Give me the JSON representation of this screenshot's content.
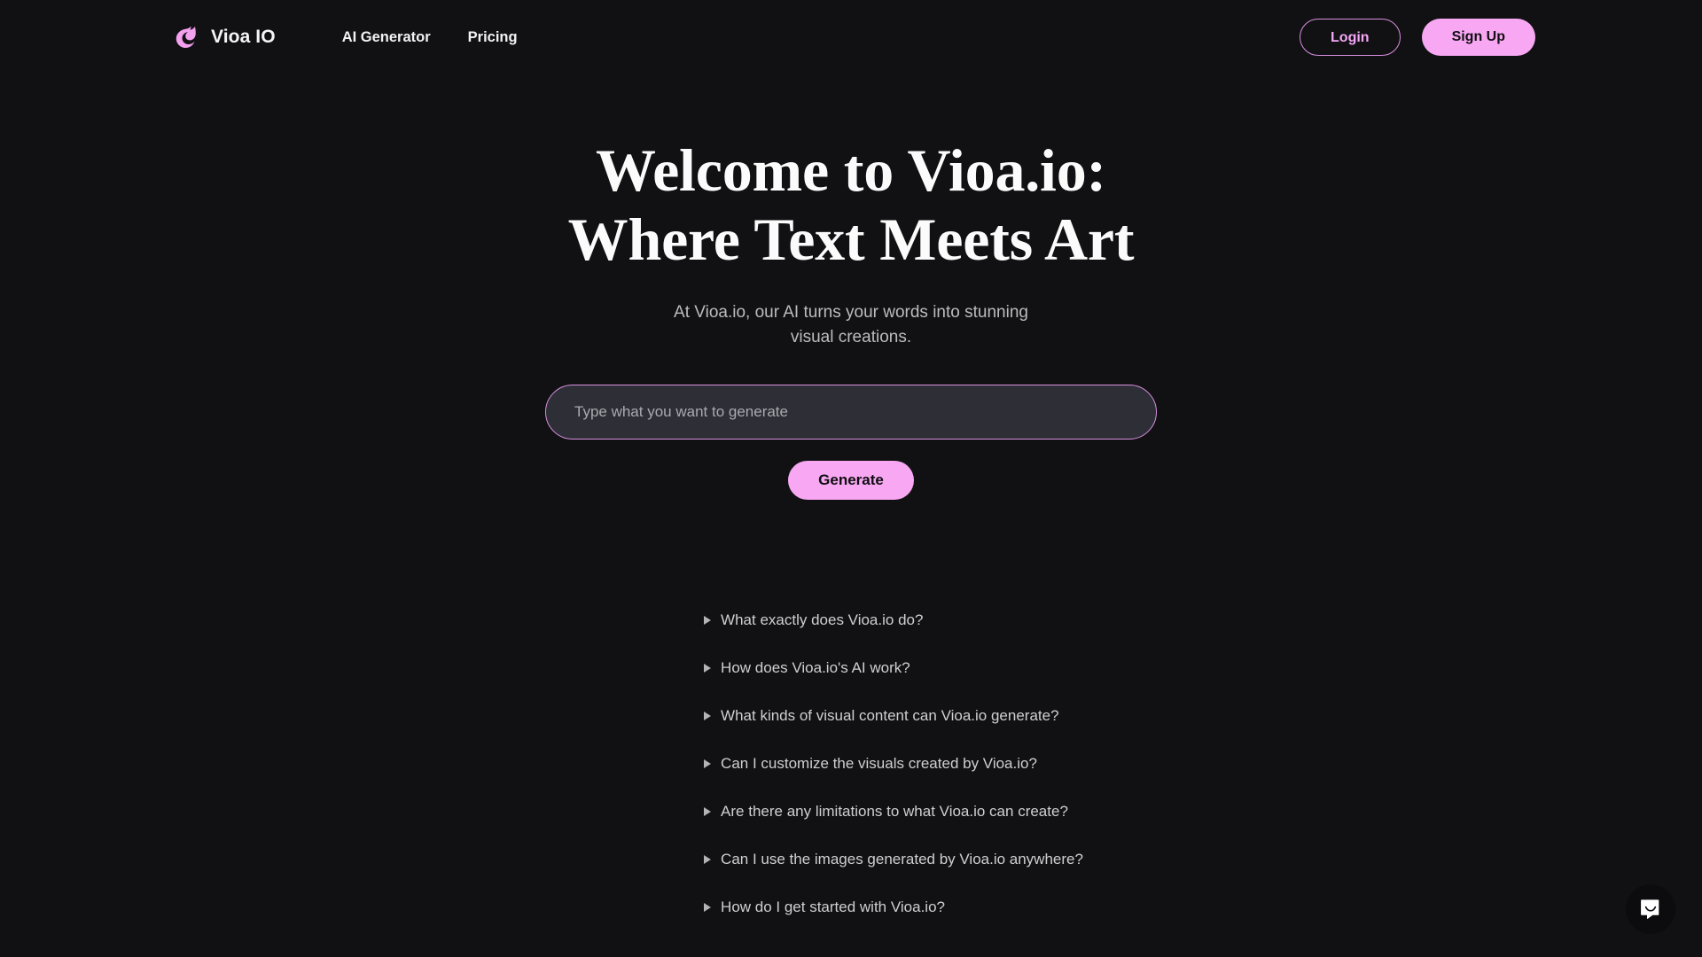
{
  "brand": {
    "name": "Vioa IO",
    "logo_icon": "dolphin-swirl-icon",
    "accent_pink": "#f8a8f3",
    "accent_pink_border": "#d88fdf",
    "background": "#111113"
  },
  "nav": {
    "links": [
      {
        "label": "AI Generator"
      },
      {
        "label": "Pricing"
      }
    ],
    "login_label": "Login",
    "signup_label": "Sign Up"
  },
  "hero": {
    "title": "Welcome to Vioa.io: Where Text Meets Art",
    "subtitle": "At Vioa.io, our AI turns your words into stunning visual creations."
  },
  "prompt": {
    "placeholder": "Type what you want to generate",
    "value": "",
    "generate_label": "Generate"
  },
  "faq": {
    "items": [
      {
        "question": "What exactly does Vioa.io do?"
      },
      {
        "question": "How does Vioa.io's AI work?"
      },
      {
        "question": "What kinds of visual content can Vioa.io generate?"
      },
      {
        "question": "Can I customize the visuals created by Vioa.io?"
      },
      {
        "question": "Are there any limitations to what Vioa.io can create?"
      },
      {
        "question": "Can I use the images generated by Vioa.io anywhere?"
      },
      {
        "question": "How do I get started with Vioa.io?"
      }
    ]
  },
  "chat": {
    "icon": "chat-bubble-smile-icon"
  }
}
